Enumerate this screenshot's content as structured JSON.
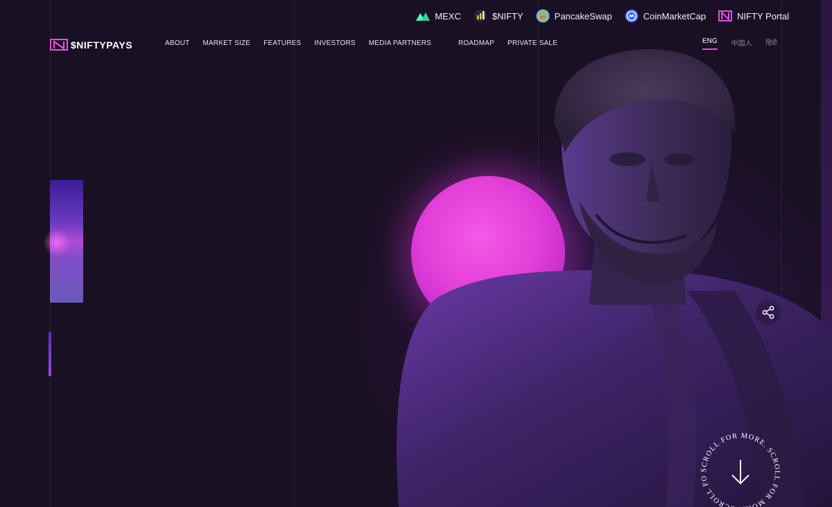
{
  "partners": [
    {
      "label": "MEXC",
      "icon": "mexc-icon"
    },
    {
      "label": "$NIFTY",
      "icon": "nifty-token-icon"
    },
    {
      "label": "PancakeSwap",
      "icon": "pancakeswap-icon"
    },
    {
      "label": "CoinMarketCap",
      "icon": "coinmarketcap-icon"
    },
    {
      "label": "NIFTY Portal",
      "icon": "nifty-portal-icon"
    }
  ],
  "header": {
    "logo_text": "$NIFTYPAYS",
    "nav": [
      "ABOUT",
      "MARKET SIZE",
      "FEATURES",
      "INVESTORS",
      "MEDIA PARTNERS",
      "ROADMAP",
      "PRIVATE SALE"
    ],
    "languages": [
      "ENG",
      "中国人",
      "हिंदी"
    ],
    "active_language": "ENG"
  },
  "scroll": {
    "text": "SCROLL FOR MORE. SCROLL FOR MORE. SCROLL FOR MORE."
  },
  "colors": {
    "background": "#1a1024",
    "accent_pink": "#e33fd9",
    "accent_purple": "#6b3ac0"
  }
}
